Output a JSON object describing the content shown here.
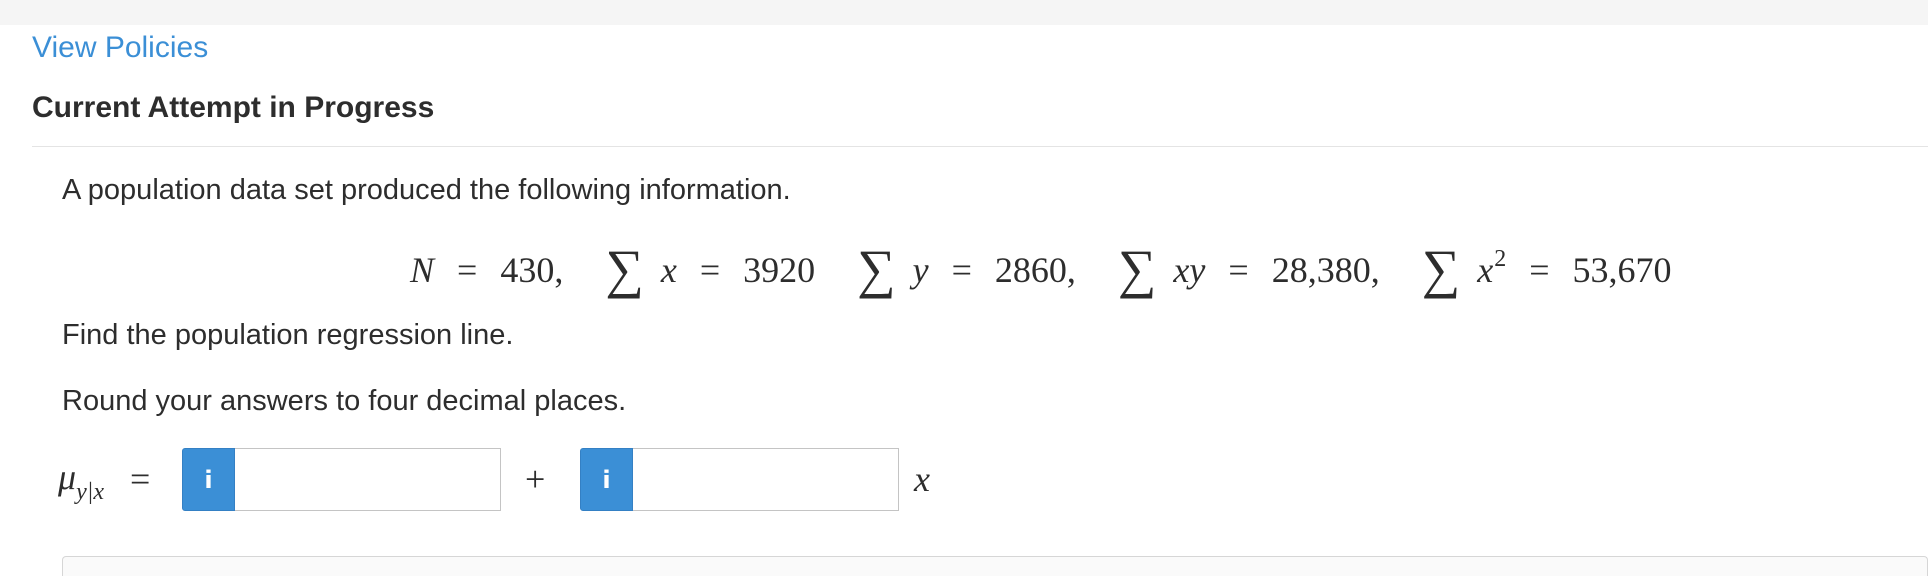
{
  "header": {
    "view_policies_label": "View Policies",
    "attempt_heading": "Current Attempt in Progress"
  },
  "question": {
    "intro": "A population data set produced the following information.",
    "given": {
      "n_var": "N",
      "n_value": "430,",
      "sigma_symbol": "∑",
      "sum_x_var": "x",
      "sum_x_value": "3920",
      "sum_y_var": "y",
      "sum_y_value": "2860,",
      "sum_xy_var": "xy",
      "sum_xy_value": "28,380,",
      "sum_x2_var": "x",
      "sum_x2_exp": "2",
      "sum_x2_value": "53,670",
      "equals_sign": "="
    },
    "instruction": "Find the population regression line.",
    "rounding_note": "Round your answers to four decimal places."
  },
  "answer": {
    "mu_symbol": "μ",
    "mu_subscript": "y|x",
    "equals_sign": "=",
    "plus_sign": "+",
    "x_var": "x",
    "info_icon_label": "i",
    "intercept_value": "",
    "slope_value": ""
  },
  "colors": {
    "link": "#3b8fd6",
    "info_button": "#3b8fd6",
    "text": "#2d2d2d"
  }
}
